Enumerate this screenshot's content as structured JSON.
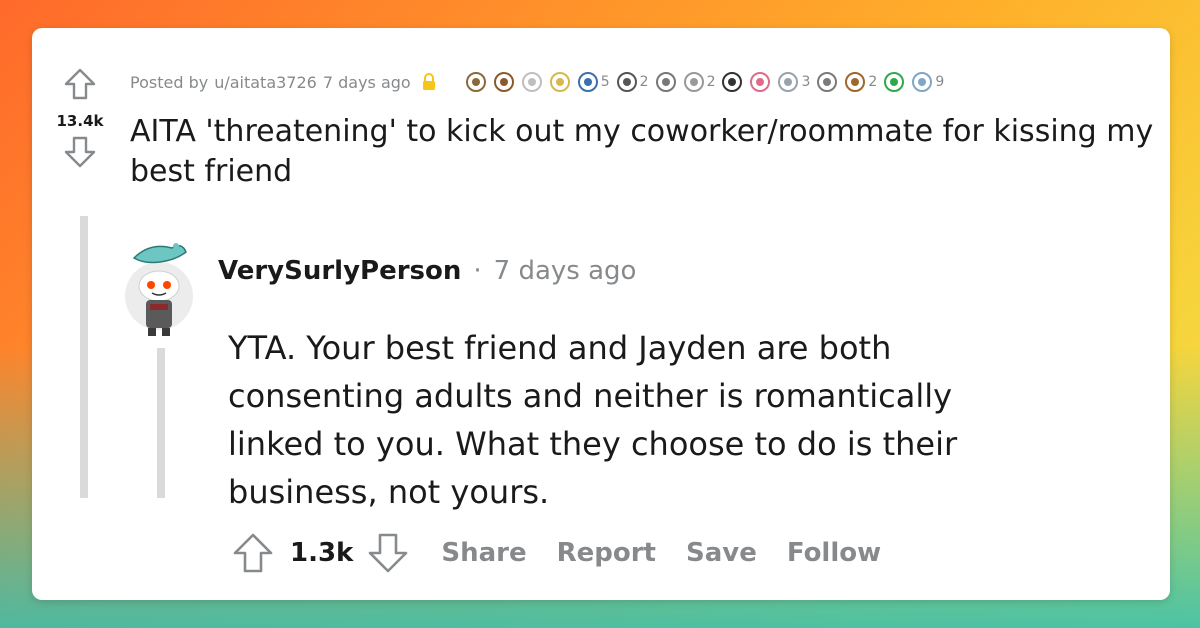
{
  "post": {
    "posted_by_prefix": "Posted by",
    "author": "u/aitata3726",
    "age": "7 days ago",
    "score": "13.4k",
    "title": "AITA 'threatening' to kick out my coworker/roommate for kissing my best friend",
    "awards": [
      {
        "icon": "sword-award-icon",
        "count": ""
      },
      {
        "icon": "poop-award-icon",
        "count": ""
      },
      {
        "icon": "toilet-paper-award-icon",
        "count": ""
      },
      {
        "icon": "wizard-award-icon",
        "count": ""
      },
      {
        "icon": "snoo-glasses-award-icon",
        "count": "5"
      },
      {
        "icon": "skull-award-icon",
        "count": "2"
      },
      {
        "icon": "facepalm-award-icon",
        "count": ""
      },
      {
        "icon": "laughing-face-award-icon",
        "count": "2"
      },
      {
        "icon": "shocked-snoo-award-icon",
        "count": ""
      },
      {
        "icon": "confetti-snoo-award-icon",
        "count": ""
      },
      {
        "icon": "silver-award-icon",
        "count": "3"
      },
      {
        "icon": "snoo-hug-award-icon",
        "count": ""
      },
      {
        "icon": "bear-award-icon",
        "count": "2"
      },
      {
        "icon": "green-dino-award-icon",
        "count": ""
      },
      {
        "icon": "blue-dragon-award-icon",
        "count": "9"
      }
    ]
  },
  "comment": {
    "username": "VerySurlyPerson",
    "separator": "·",
    "age": "7 days ago",
    "body": "YTA. Your best friend and Jayden are both consenting adults and neither is romantically linked to you. What they choose to do is their business, not yours.",
    "score": "1.3k",
    "actions": {
      "share": "Share",
      "report": "Report",
      "save": "Save",
      "follow": "Follow"
    }
  },
  "colors": {
    "text": "#1a1a1b",
    "muted": "#878a8c",
    "thread": "#dadada",
    "lock": "#f5c518"
  }
}
